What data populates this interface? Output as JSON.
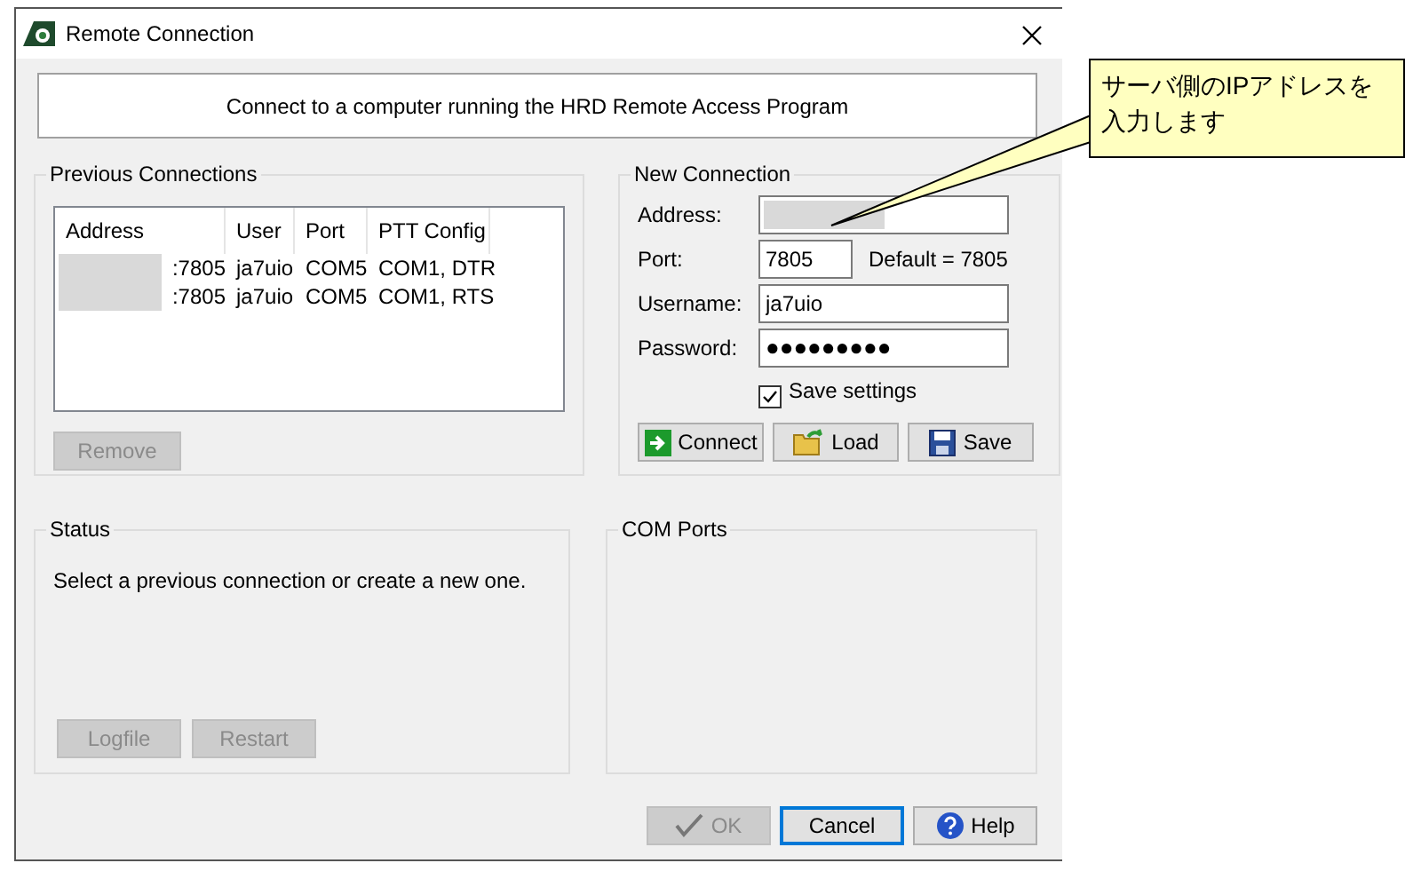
{
  "window": {
    "title": "Remote Connection"
  },
  "banner": "Connect to a computer running the HRD Remote Access Program",
  "previous_connections": {
    "title": "Previous Connections",
    "columns": [
      "Address",
      "User",
      "Port",
      "PTT Config"
    ],
    "rows": [
      {
        "address": ":7805",
        "user": "ja7uio",
        "port": "COM5",
        "ptt": "COM1, DTR"
      },
      {
        "address": ":7805",
        "user": "ja7uio",
        "port": "COM5",
        "ptt": "COM1, RTS"
      }
    ],
    "remove_button": {
      "label": "Remove",
      "disabled": true
    }
  },
  "new_connection": {
    "title": "New Connection",
    "fields": [
      {
        "label": "Address:",
        "kind": "redacted"
      },
      {
        "label": "Port:",
        "value": "7805",
        "kind": "short",
        "note": "Default = 7805"
      },
      {
        "label": "Username:",
        "value": "ja7uio",
        "kind": "text"
      },
      {
        "label": "Password:",
        "value": "●●●●●●●●●",
        "kind": "password"
      }
    ],
    "save_settings": {
      "label": "Save settings",
      "checked": true
    },
    "buttons": [
      {
        "label": "Connect",
        "kind": "connect"
      },
      {
        "label": "Load",
        "kind": "load"
      },
      {
        "label": "Save",
        "kind": "save"
      }
    ]
  },
  "status": {
    "title": "Status",
    "message": "Select a previous connection or create a new one.",
    "buttons": [
      {
        "label": "Logfile",
        "disabled": true
      },
      {
        "label": "Restart",
        "disabled": true
      }
    ]
  },
  "com_ports": {
    "title": "COM Ports"
  },
  "footer_buttons": [
    {
      "label": "OK",
      "kind": "ok",
      "disabled": true,
      "focused": false
    },
    {
      "label": "Cancel",
      "kind": "none",
      "disabled": false,
      "focused": true
    },
    {
      "label": "Help",
      "kind": "help",
      "disabled": false,
      "focused": false
    }
  ],
  "callout": {
    "lines": [
      "サーバ側のIPアドレスを",
      "入力します"
    ]
  }
}
